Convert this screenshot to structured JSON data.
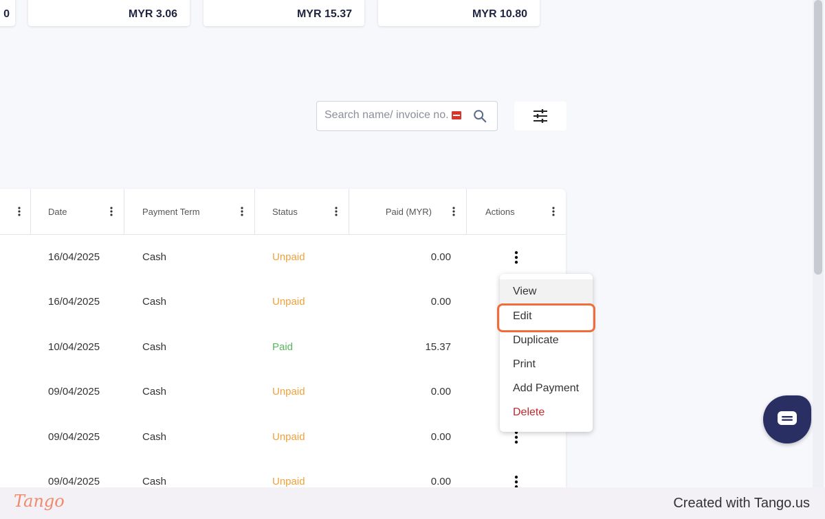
{
  "summary_cards": [
    {
      "label": "",
      "amount": "MYR 3.06"
    },
    {
      "label": "",
      "amount": "MYR 15.37"
    },
    {
      "label": "",
      "amount": "MYR 10.80"
    }
  ],
  "search": {
    "placeholder": "Search name/ invoice no."
  },
  "table": {
    "columns": [
      "Date",
      "Payment Term",
      "Status",
      "Paid (MYR)",
      "Actions"
    ],
    "rows": [
      {
        "date": "16/04/2025",
        "term": "Cash",
        "status": "Unpaid",
        "paid": "0.00"
      },
      {
        "date": "16/04/2025",
        "term": "Cash",
        "status": "Unpaid",
        "paid": "0.00"
      },
      {
        "date": "10/04/2025",
        "term": "Cash",
        "status": "Paid",
        "paid": "15.37"
      },
      {
        "date": "09/04/2025",
        "term": "Cash",
        "status": "Unpaid",
        "paid": "0.00"
      },
      {
        "date": "09/04/2025",
        "term": "Cash",
        "status": "Unpaid",
        "paid": "0.00"
      },
      {
        "date": "09/04/2025",
        "term": "Cash",
        "status": "Unpaid",
        "paid": "0.00"
      }
    ]
  },
  "action_menu": {
    "items": [
      "View",
      "Edit",
      "Duplicate",
      "Print",
      "Add Payment",
      "Delete"
    ],
    "highlighted": "Edit"
  },
  "footer": {
    "logo": "Tango",
    "text": "Created with Tango.us"
  },
  "colors": {
    "unpaid": "#f0a13a",
    "paid": "#57b55a",
    "danger": "#c0282d",
    "highlight": "#f26b38",
    "chat": "#2a2f63"
  }
}
